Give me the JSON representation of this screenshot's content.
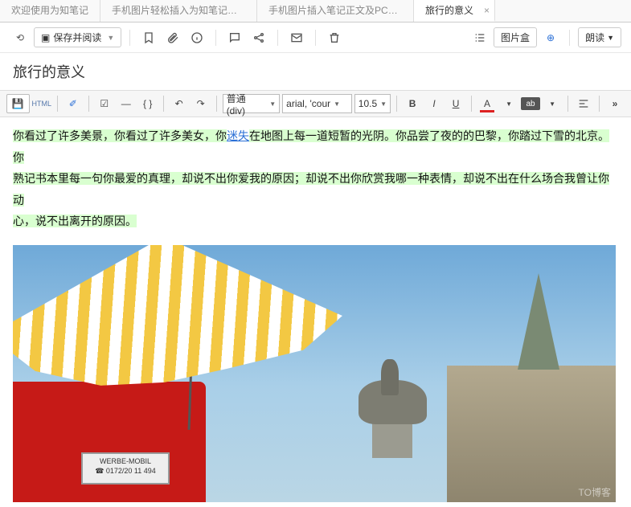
{
  "tabs": [
    {
      "label": "欢迎使用为知笔记"
    },
    {
      "label": "手机图片轻松插入为知笔记电脑..."
    },
    {
      "label": "手机图片插入笔记正文及PC平..."
    },
    {
      "label": "旅行的意义",
      "active": true
    }
  ],
  "toolbar1": {
    "save_label": "保存并阅读",
    "imagebox_label": "图片盒",
    "read_label": "朗读"
  },
  "note_title": "旅行的意义",
  "editorbar": {
    "html_btn": "HTML",
    "format_sel": "普通 (div)",
    "font_sel": "arial, 'cour",
    "size_sel": "10.5"
  },
  "body": {
    "p1a": "你看过了许多美景，你看过了许多美女，你",
    "p1link": "迷失",
    "p1b": "在地图上每一道短暂的光阴。你品尝了夜的的巴黎，你踏过下雪的北京。你",
    "p2": "熟记书本里每一句你最爱的真理，却说不出你爱我的原因；却说不出你欣赏我哪一种表情，却说不出在什么场合我曾让你动",
    "p3": "心，说不出离开的原因。"
  },
  "plate": {
    "l1": "WERBE-MOBIL",
    "l2": "☎ 0172/20 11 494"
  },
  "watermark": "TO博客"
}
